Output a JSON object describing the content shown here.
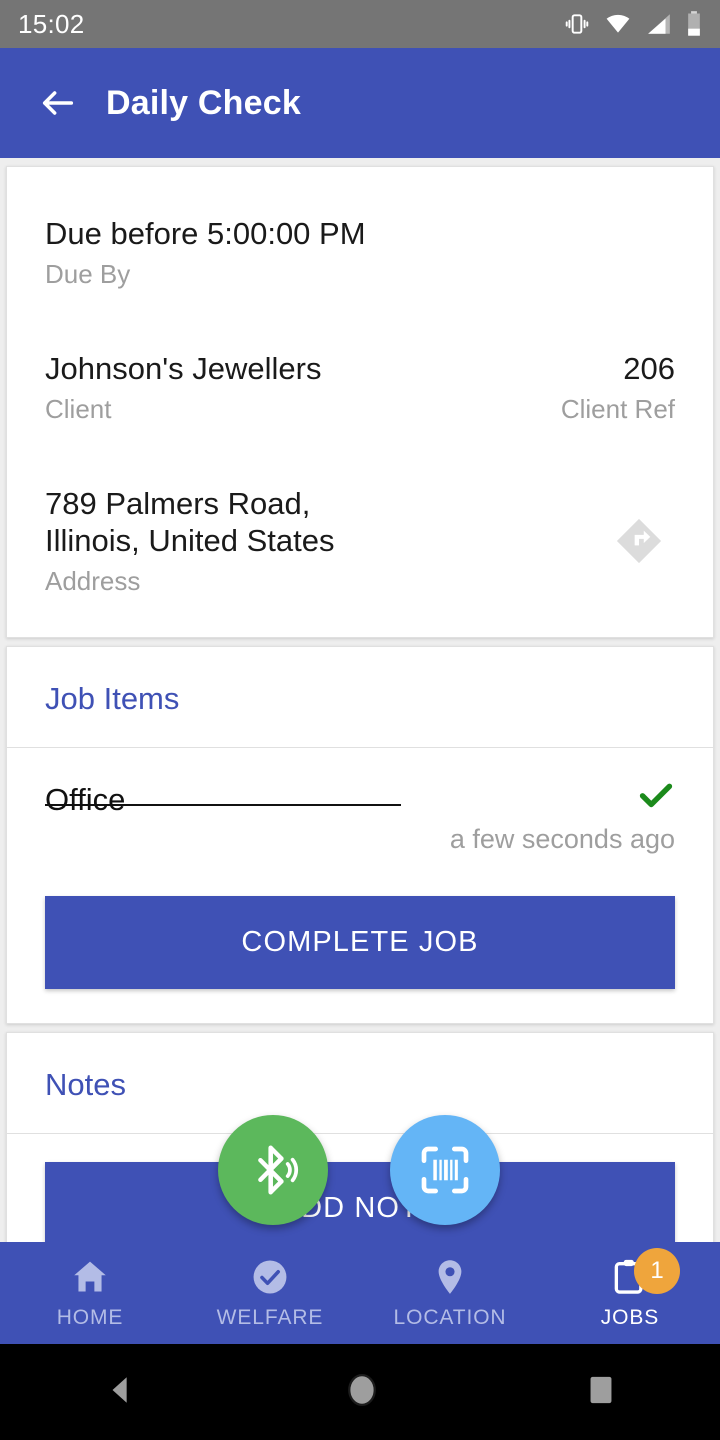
{
  "status_bar": {
    "time": "15:02",
    "icons": [
      "vibrate-icon",
      "wifi-icon",
      "signal-icon",
      "battery-icon"
    ]
  },
  "app_bar": {
    "back_label": "back-arrow",
    "title": "Daily Check"
  },
  "details_card": {
    "due": {
      "value": "Due before 5:00:00 PM",
      "label": "Due By"
    },
    "client": {
      "value": "Johnson's Jewellers",
      "label": "Client"
    },
    "client_ref": {
      "value": "206",
      "label": "Client Ref"
    },
    "address": {
      "line1": "789 Palmers Road,",
      "line2": "Illinois, United States",
      "label": "Address",
      "directions_icon": "directions-icon"
    }
  },
  "job_items_card": {
    "title": "Job Items",
    "items": [
      {
        "name": "Office",
        "completed": true,
        "time": "a few seconds ago",
        "check_icon": "check-icon"
      }
    ],
    "complete_button": "COMPLETE JOB"
  },
  "notes_card": {
    "title": "Notes",
    "add_button": "ADD NOTE"
  },
  "fabs": [
    {
      "name": "bluetooth-fab",
      "icon": "bluetooth-audio-icon",
      "color": "#5cb85c"
    },
    {
      "name": "barcode-fab",
      "icon": "barcode-scan-icon",
      "color": "#64b5f6"
    }
  ],
  "bottom_nav": {
    "items": [
      {
        "label": "HOME",
        "icon": "home-icon",
        "active": false
      },
      {
        "label": "WELFARE",
        "icon": "check-circle-icon",
        "active": false
      },
      {
        "label": "LOCATION",
        "icon": "map-pin-icon",
        "active": false
      },
      {
        "label": "JOBS",
        "icon": "clipboard-icon",
        "active": true,
        "badge": "1"
      }
    ]
  },
  "android_nav": {
    "back": "back-triangle-icon",
    "home": "home-circle-icon",
    "recents": "recents-square-icon"
  },
  "colors": {
    "primary": "#3f51b5",
    "status_bar": "#757575",
    "accent_green": "#1b8a1b",
    "badge_orange": "#efa53c",
    "fab_green": "#5cb85c",
    "fab_blue": "#64b5f6"
  }
}
